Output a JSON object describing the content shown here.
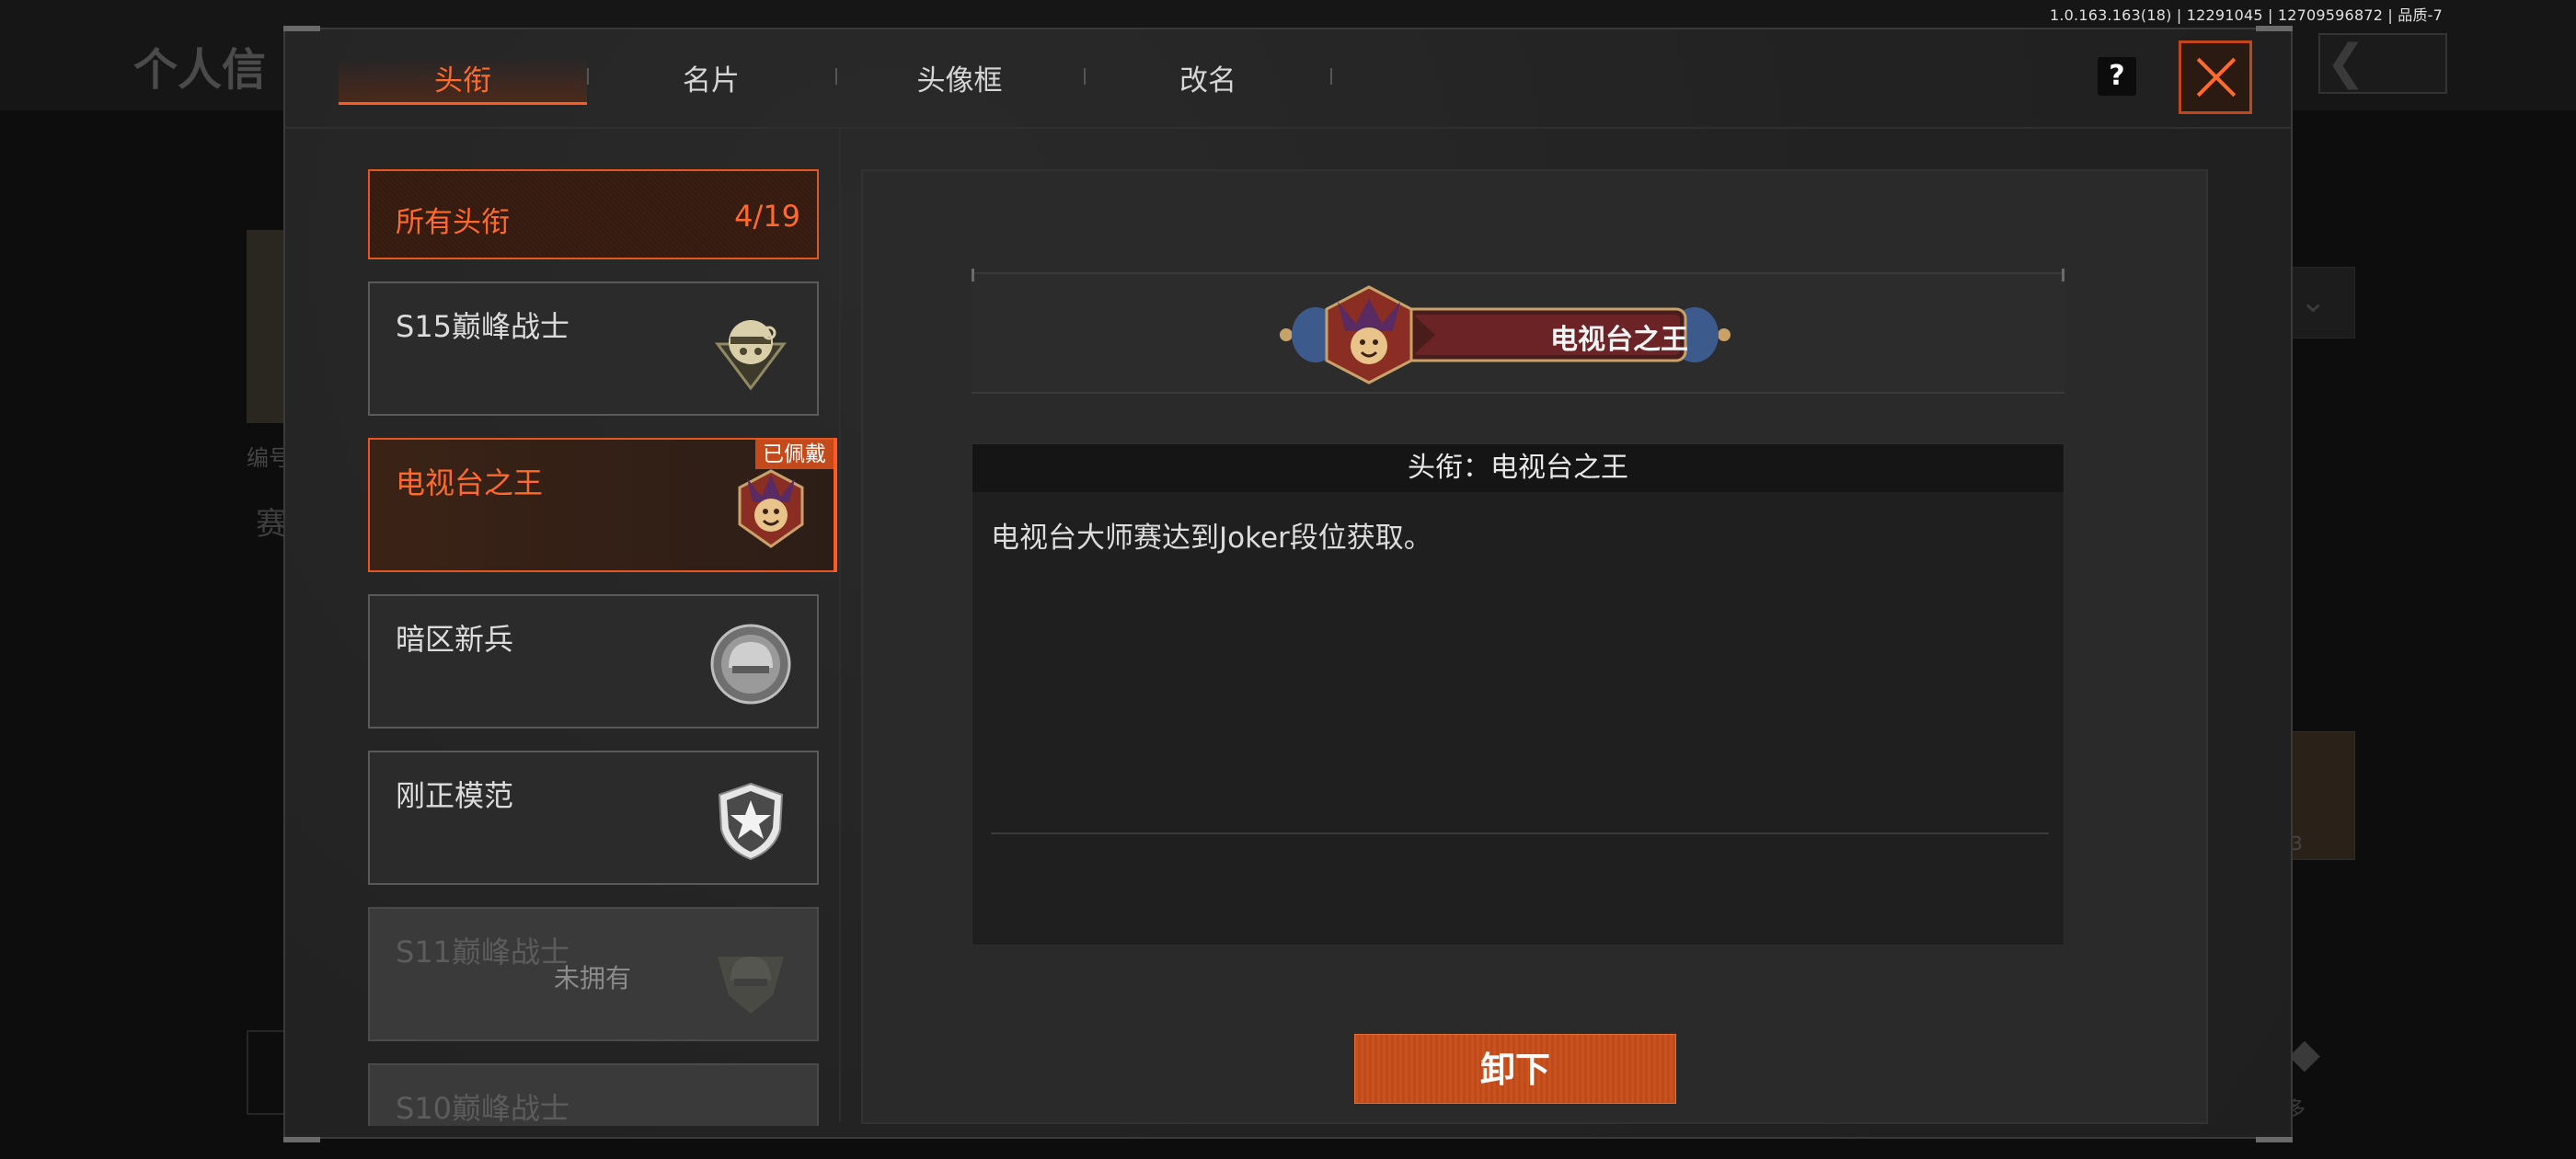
{
  "version_info": "1.0.163.163(18) | 12291045 | 12709596872 | 品质-7",
  "background": {
    "page_title": "个人信",
    "bian_label": "编号",
    "sai_label": "赛",
    "right_card_num": "3",
    "more_label": "多"
  },
  "tabs": [
    {
      "label": "头衔",
      "active": true
    },
    {
      "label": "名片",
      "active": false
    },
    {
      "label": "头像框",
      "active": false
    },
    {
      "label": "改名",
      "active": false
    }
  ],
  "help_label": "?",
  "title_list": {
    "header_label": "所有头衔",
    "header_count": "4/19",
    "items": [
      {
        "label": "S15巅峰战士",
        "icon": "skull-emblem-icon",
        "state": "owned"
      },
      {
        "label": "电视台之王",
        "icon": "jester-emblem-icon",
        "state": "selected",
        "tag": "已佩戴"
      },
      {
        "label": "暗区新兵",
        "icon": "helmet-emblem-icon",
        "state": "owned"
      },
      {
        "label": "刚正模范",
        "icon": "star-shield-icon",
        "state": "owned"
      },
      {
        "label": "S11巅峰战士",
        "icon": "helmet-wreath-icon",
        "state": "locked",
        "status": "未拥有"
      },
      {
        "label": "S10巅峰战士",
        "icon": "",
        "state": "locked"
      }
    ]
  },
  "detail": {
    "banner_title": "电视台之王",
    "description_title": "头衔：电视台之王",
    "description": "电视台大师赛达到Joker段位获取。",
    "unequip_label": "卸下"
  },
  "colors": {
    "accent": "#ff6a2a",
    "accent_dark": "#c4491b",
    "panel": "#2a2a2a",
    "text": "#dcdcdc"
  }
}
